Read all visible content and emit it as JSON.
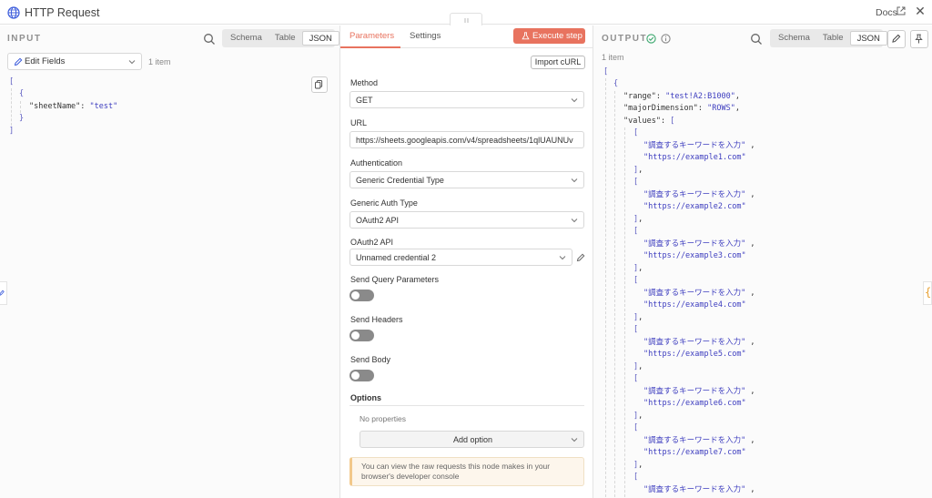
{
  "titlebar": {
    "title": "HTTP Request",
    "docs_label": "Docs",
    "close_glyph": "✕"
  },
  "input": {
    "header": "INPUT",
    "views": [
      "Schema",
      "Table",
      "JSON"
    ],
    "active_view": "JSON",
    "edit_fields_label": "Edit Fields",
    "item_count": "1 item",
    "json_lines": [
      {
        "text": "[",
        "cls": "brk"
      },
      {
        "text": "{",
        "cls": "brk"
      },
      {
        "key": "\"sheetName\"",
        "sep": ": ",
        "val": "\"test\""
      },
      {
        "text": "}",
        "cls": "brk"
      },
      {
        "text": "]",
        "cls": "brk"
      }
    ]
  },
  "params": {
    "tabs": [
      "Parameters",
      "Settings"
    ],
    "active_tab": "Parameters",
    "execute_label": "Execute step",
    "import_curl_label": "Import cURL",
    "method_label": "Method",
    "method_value": "GET",
    "url_label": "URL",
    "url_value": "https://sheets.googleapis.com/v4/spreadsheets/1qlUAUNUv",
    "auth_label": "Authentication",
    "auth_value": "Generic Credential Type",
    "generic_auth_label": "Generic Auth Type",
    "generic_auth_value": "OAuth2 API",
    "oauth_label": "OAuth2 API",
    "oauth_value": "Unnamed credential 2",
    "send_query_label": "Send Query Parameters",
    "send_headers_label": "Send Headers",
    "send_body_label": "Send Body",
    "toggles": {
      "send_query": false,
      "send_headers": false,
      "send_body": false
    },
    "options_label": "Options",
    "no_properties": "No properties",
    "add_option_label": "Add option",
    "notice": "You can view the raw requests this node makes in your browser's developer console"
  },
  "output": {
    "header": "OUTPUT",
    "views": [
      "Schema",
      "Table",
      "JSON"
    ],
    "active_view": "JSON",
    "item_count": "1 item",
    "range_key": "\"range\"",
    "range_val": "\"test!A2:B1000\"",
    "dim_key": "\"majorDimension\"",
    "dim_val": "\"ROWS\"",
    "values_key": "\"values\"",
    "rows": [
      {
        "keyword": "\"調査するキーワードを入力\"",
        "url": "\"https://example1.com\""
      },
      {
        "keyword": "\"調査するキーワードを入力\"",
        "url": "\"https://example2.com\""
      },
      {
        "keyword": "\"調査するキーワードを入力\"",
        "url": "\"https://example3.com\""
      },
      {
        "keyword": "\"調査するキーワードを入力\"",
        "url": "\"https://example4.com\""
      },
      {
        "keyword": "\"調査するキーワードを入力\"",
        "url": "\"https://example5.com\""
      },
      {
        "keyword": "\"調査するキーワードを入力\"",
        "url": "\"https://example6.com\""
      },
      {
        "keyword": "\"調査するキーワードを入力\"",
        "url": "\"https://example7.com\""
      },
      {
        "keyword": "\"調査するキーワードを入力\"",
        "url": ""
      }
    ]
  },
  "colors": {
    "accent": "#e8735f",
    "json_string": "#3d3dbf",
    "success": "#3aa76d"
  }
}
